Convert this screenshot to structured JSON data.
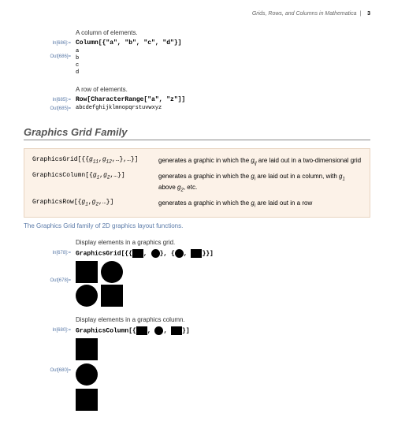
{
  "header": {
    "title": "Grids, Rows, and Columns in Mathematica",
    "page": "3"
  },
  "ex1": {
    "comment": "A column of elements.",
    "in_label": "In[686]:=",
    "code": "Column[{\"a\", \"b\", \"c\", \"d\"}]",
    "out_label": "Out[686]=",
    "out": [
      "a",
      "b",
      "c",
      "d"
    ]
  },
  "ex2": {
    "comment": "A row of elements.",
    "in_label": "In[685]:=",
    "code": "Row[CharacterRange[\"a\", \"z\"]]",
    "out_label": "Out[685]=",
    "out": "abcdefghijklmnopqrstuvwxyz"
  },
  "section2": "Graphics Grid Family",
  "ref": {
    "r1": {
      "fn": "GraphicsGrid",
      "desc1": "generates a graphic in which the ",
      "desc2": " are laid out in a two-dimensional grid"
    },
    "r2": {
      "fn": "GraphicsColumn",
      "desc1": "generates a graphic in which the ",
      "desc2": " are laid out in a column, with ",
      "desc3": " above ",
      "desc4": ", etc."
    },
    "r3": {
      "fn": "GraphicsRow",
      "desc1": "generates a graphic in which the ",
      "desc2": " are laid out in a row"
    }
  },
  "caption": "The Graphics Grid family of 2D graphics layout functions.",
  "ex3": {
    "comment": "Display elements in a graphics grid.",
    "in_label": "In[678]:=",
    "fn": "GraphicsGrid",
    "out_label": "Out[678]="
  },
  "ex4": {
    "comment": "Display elements in a graphics column.",
    "in_label": "In[680]:=",
    "fn": "GraphicsColumn",
    "out_label": "Out[680]="
  }
}
